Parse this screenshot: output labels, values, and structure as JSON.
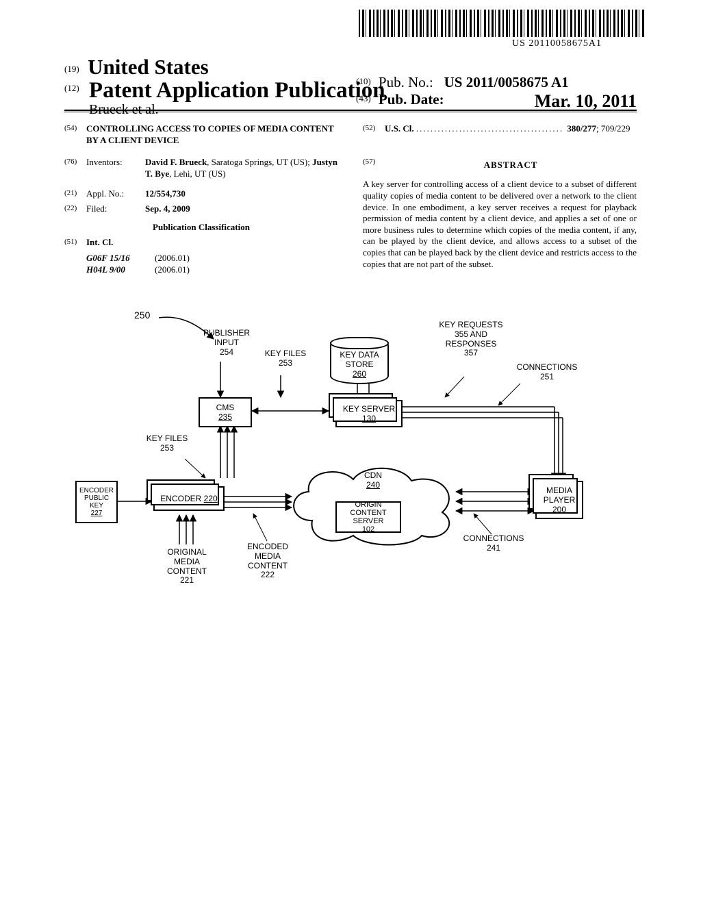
{
  "barcode_text": "US 20110058675A1",
  "header": {
    "country_code": "(19)",
    "country": "United States",
    "pub_type_code": "(12)",
    "pub_type": "Patent Application Publication",
    "author_line": "Brueck et al.",
    "pub_no_code": "(10)",
    "pub_no_label": "Pub. No.:",
    "pub_no": "US 2011/0058675 A1",
    "pub_date_code": "(43)",
    "pub_date_label": "Pub. Date:",
    "pub_date": "Mar. 10, 2011"
  },
  "left": {
    "title_code": "(54)",
    "title": "CONTROLLING ACCESS TO COPIES OF MEDIA CONTENT BY A CLIENT DEVICE",
    "inventors_code": "(76)",
    "inventors_label": "Inventors:",
    "inventors_html": "David F. Brueck, Saratoga Springs, UT (US); Justyn T. Bye, Lehi, UT (US)",
    "inventors_b1": "David F. Brueck",
    "inventors_t1": ", Saratoga Springs, UT (US); ",
    "inventors_b2": "Justyn T. Bye",
    "inventors_t2": ", Lehi, UT (US)",
    "appl_code": "(21)",
    "appl_label": "Appl. No.:",
    "appl_no": "12/554,730",
    "filed_code": "(22)",
    "filed_label": "Filed:",
    "filed": "Sep. 4, 2009",
    "pubclass_heading": "Publication Classification",
    "intcl_code": "(51)",
    "intcl_label": "Int. Cl.",
    "intcl": [
      {
        "code": "G06F 15/16",
        "ver": "(2006.01)"
      },
      {
        "code": "H04L 9/00",
        "ver": "(2006.01)"
      }
    ]
  },
  "right": {
    "uscl_code": "(52)",
    "uscl_label": "U.S. Cl.",
    "uscl_bold": "380/277",
    "uscl_rest": "; 709/229",
    "abs_code": "(57)",
    "abs_heading": "ABSTRACT",
    "abstract": "A key server for controlling access of a client device to a subset of different quality copies of media content to be delivered over a network to the client device. In one embodiment, a key server receives a request for playback permission of media content by a client device, and applies a set of one or more business rules to determine which copies of the media content, if any, can be played by the client device, and allows access to a subset of the copies that can be played back by the client device and restricts access to the copies that are not part of the subset."
  },
  "diagram": {
    "ref_250": "250",
    "publisher_input": "PUBLISHER INPUT",
    "publisher_input_n": "254",
    "key_files": "KEY FILES",
    "key_files_n": "253",
    "key_data_store": "KEY DATA STORE",
    "key_data_store_n": "260",
    "key_requests": "KEY REQUESTS",
    "key_requests_n": "355 AND",
    "responses": "RESPONSES",
    "responses_n": "357",
    "connections": "CONNECTIONS",
    "connections_n1": "251",
    "connections_n2": "241",
    "cms": "CMS",
    "cms_n": "235",
    "key_server": "KEY SERVER",
    "key_server_n": "130",
    "encoder": "ENCODER",
    "encoder_n": "220",
    "encoder_pk": "ENCODER PUBLIC KEY",
    "encoder_pk_n": "227",
    "cdn": "CDN",
    "cdn_n": "240",
    "origin": "ORIGIN CONTENT SERVER",
    "origin_n": "102",
    "media_player": "MEDIA PLAYER",
    "media_player_n": "200",
    "original_media": "ORIGINAL MEDIA CONTENT",
    "original_media_n": "221",
    "encoded_media": "ENCODED MEDIA CONTENT",
    "encoded_media_n": "222"
  }
}
